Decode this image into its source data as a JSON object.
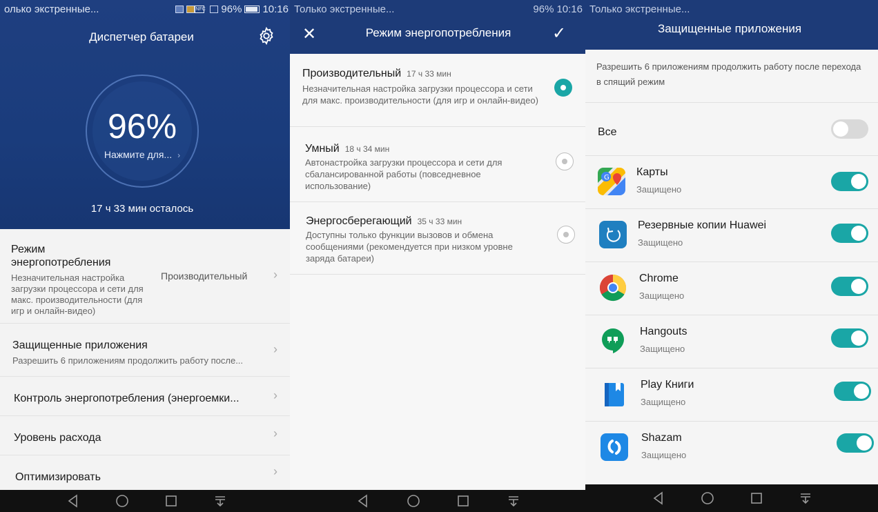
{
  "status": {
    "carrier_left": "олько экстренные...",
    "carrier_mid": "Только экстренные...",
    "carrier_right": "Только экстренные...",
    "battery_percent": "96%",
    "time": "10:16",
    "nfc": "NFC"
  },
  "battery_manager": {
    "title": "Диспетчер батареи",
    "percent": "96%",
    "tap_hint": "Нажмите для...",
    "remaining": "17 ч 33 мин осталось",
    "items": [
      {
        "title": "Режим энергопотребления",
        "subtitle": "Незначительная настройка загрузки процессора и сети для макс. производительности (для игр и онлайн-видео)",
        "value": "Производительный"
      },
      {
        "title": "Защищенные приложения",
        "subtitle": "Разрешить 6 приложениям продолжить работу после..."
      },
      {
        "title": "Контроль энергопотребления (энергоемки..."
      },
      {
        "title": "Уровень расхода"
      },
      {
        "title": "Оптимизировать"
      }
    ]
  },
  "power_mode": {
    "title": "Режим энергопотребления",
    "modes": [
      {
        "name": "Производительный",
        "time": "17 ч 33 мин",
        "desc": "Незначительная настройка загрузки процессора и сети для макс. производительности (для игр и онлайн-видео)",
        "selected": true
      },
      {
        "name": "Умный",
        "time": "18 ч 34 мин",
        "desc": "Автонастройка загрузки процессора и сети для сбалансированной работы (повседневное использование)",
        "selected": false
      },
      {
        "name": "Энергосберегающий",
        "time": "35 ч 33 мин",
        "desc": "Доступны только функции вызовов и обмена сообщениями (рекомендуется при низком уровне заряда батареи)",
        "selected": false
      }
    ]
  },
  "protected_apps": {
    "title": "Защищенные приложения",
    "description": "Разрешить 6 приложениям продолжить работу после перехода в спящий режим",
    "all_label": "Все",
    "all_enabled": false,
    "apps": [
      {
        "name": "Карты",
        "status": "Защищено",
        "icon": "maps-icon",
        "enabled": true
      },
      {
        "name": "Резервные копии Huawei",
        "status": "Защищено",
        "icon": "backup-icon",
        "enabled": true
      },
      {
        "name": "Chrome",
        "status": "Защищено",
        "icon": "chrome-icon",
        "enabled": true
      },
      {
        "name": "Hangouts",
        "status": "Защищено",
        "icon": "hangouts-icon",
        "enabled": true
      },
      {
        "name": "Play Книги",
        "status": "Защищено",
        "icon": "play-books-icon",
        "enabled": true
      },
      {
        "name": "Shazam",
        "status": "Защищено",
        "icon": "shazam-icon",
        "enabled": true
      }
    ]
  },
  "colors": {
    "header_blue": "#1d3b78",
    "accent_teal": "#1aa6a6"
  }
}
